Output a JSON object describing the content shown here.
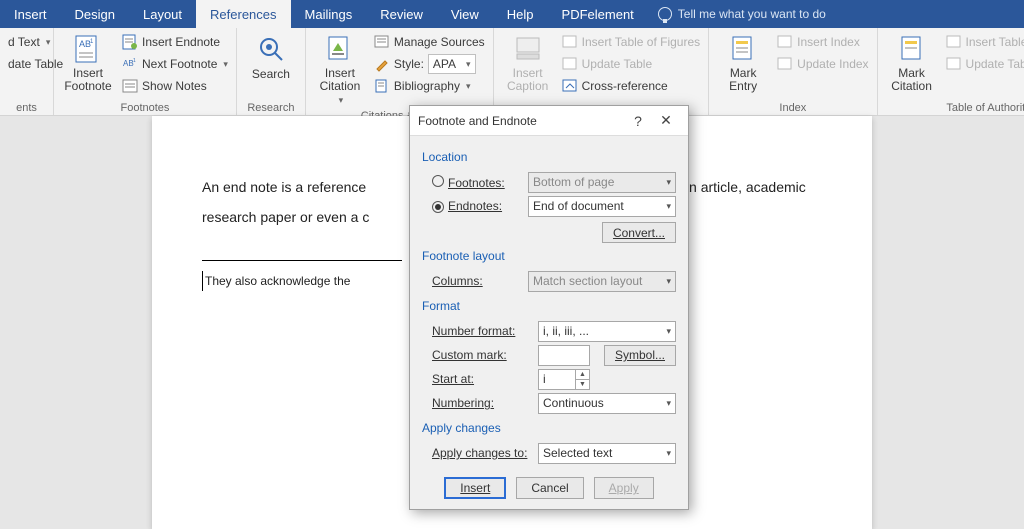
{
  "tabs": {
    "insert": "Insert",
    "design": "Design",
    "layout": "Layout",
    "references": "References",
    "mailings": "Mailings",
    "review": "Review",
    "view": "View",
    "help": "Help",
    "pdfelement": "PDFelement",
    "tellme": "Tell me what you want to do"
  },
  "ribbon": {
    "toc": {
      "addText": "d Text",
      "updateTable": "date Table",
      "group": "ents"
    },
    "footnotes": {
      "insert": "Insert Footnote",
      "ab": "AB",
      "insertEndnote": "Insert Endnote",
      "nextFootnote": "Next Footnote",
      "showNotes": "Show Notes",
      "group": "Footnotes"
    },
    "research": {
      "search": "Search",
      "group": "Research"
    },
    "citations": {
      "insertCitation": "Insert Citation",
      "manageSources": "Manage Sources",
      "style": "Style:",
      "styleValue": "APA",
      "bibliography": "Bibliography",
      "group": "Citations & Bibli"
    },
    "captions": {
      "insertCaption": "Insert Caption",
      "insertTOF": "Insert Table of Figures",
      "updateTable": "Update Table",
      "crossRef": "Cross-reference",
      "group": ""
    },
    "index": {
      "markEntry": "Mark Entry",
      "insertIndex": "Insert Index",
      "updateIndex": "Update Index",
      "group": "Index"
    },
    "toa": {
      "markCitation": "Mark Citation",
      "insertTOA": "Insert Table of Authorities",
      "updateTable": "Update Table",
      "group": "Table of Authorities"
    }
  },
  "document": {
    "p1a": "An end note is a reference",
    "p1b": "d of an article, academic",
    "p2": "research paper or even a c",
    "fn": "They also acknowledge the"
  },
  "dialog": {
    "title": "Footnote and Endnote",
    "help": "?",
    "close": "✕",
    "location": "Location",
    "footnotes": "Footnotes:",
    "footnotesVal": "Bottom of page",
    "endnotes": "Endnotes:",
    "endnotesVal": "End of document",
    "convert": "Convert...",
    "footnoteLayout": "Footnote layout",
    "columns": "Columns:",
    "columnsVal": "Match section layout",
    "format": "Format",
    "numberFormat": "Number format:",
    "numberFormatVal": "i, ii, iii, ...",
    "customMark": "Custom mark:",
    "customMarkVal": "",
    "symbol": "Symbol...",
    "startAt": "Start at:",
    "startAtVal": "i",
    "numbering": "Numbering:",
    "numberingVal": "Continuous",
    "applyChanges": "Apply changes",
    "applyTo": "Apply changes to:",
    "applyToVal": "Selected text",
    "insertBtn": "Insert",
    "cancelBtn": "Cancel",
    "applyBtn": "Apply"
  }
}
